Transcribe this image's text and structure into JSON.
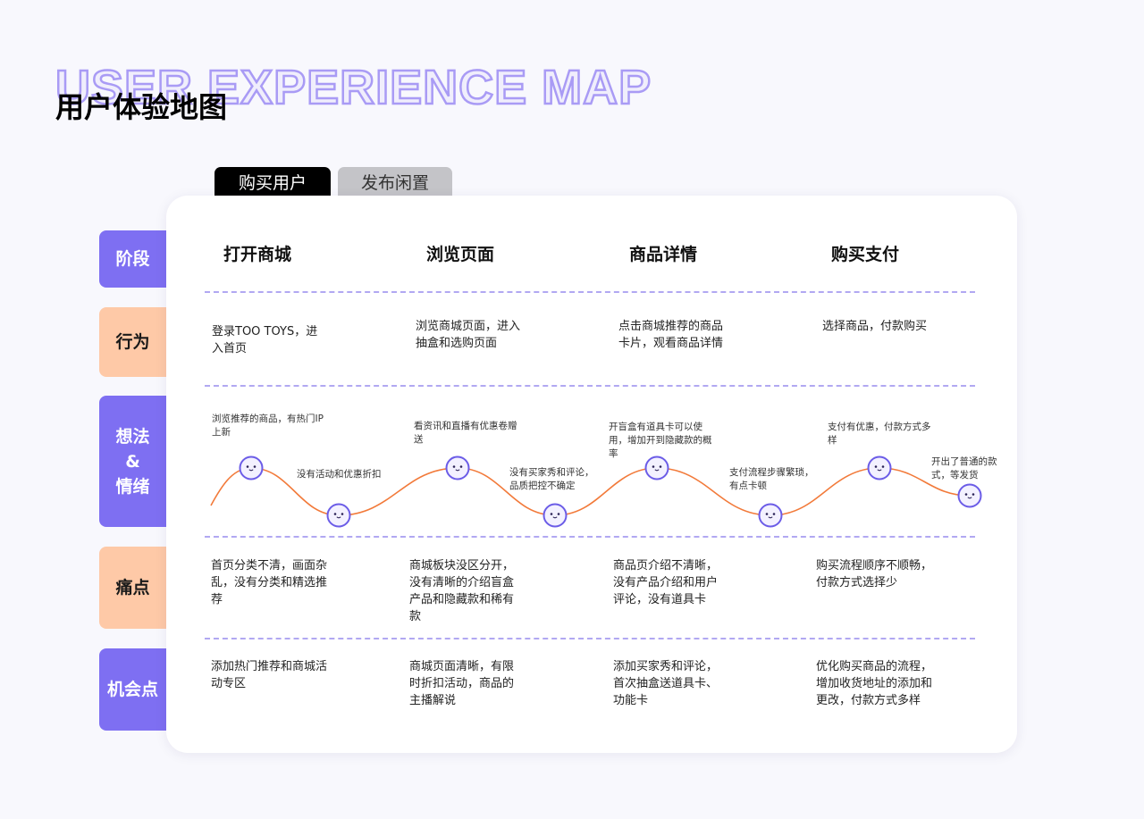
{
  "header": {
    "bg_title": "USER EXPERIENCE MAP",
    "title": "用户体验地图"
  },
  "tabs": [
    {
      "label": "购买用户",
      "active": true
    },
    {
      "label": "发布闲置",
      "active": false
    }
  ],
  "rows": {
    "stage": "阶段",
    "behavior": "行为",
    "thought": "想法\n&\n情绪",
    "pain": "痛点",
    "opportunity": "机会点"
  },
  "stages": [
    "打开商城",
    "浏览页面",
    "商品详情",
    "购买支付"
  ],
  "behaviors": [
    "登录TOO TOYS，进入首页",
    "浏览商城页面，进入抽盒和选购页面",
    "点击商城推荐的商品卡片，观看商品详情",
    "选择商品，付款购买"
  ],
  "thoughts": [
    "浏览推荐的商品，有热门IP上新",
    "没有活动和优惠折扣",
    "看资讯和直播有优惠卷赠送",
    "没有买家秀和评论，品质把控不确定",
    "开盲盒有道具卡可以使用，增加开到隐藏款的概率",
    "支付流程步骤繁琐，有点卡顿",
    "支付有优惠，付款方式多样",
    "开出了普通的款式，等发货"
  ],
  "pain_points": [
    "首页分类不清，画面杂乱，没有分类和精选推荐",
    "商城板块没区分开，没有清晰的介绍盲盒产品和隐藏款和稀有款",
    "商品页介绍不清晰，没有产品介绍和用户评论，没有道具卡",
    "购买流程顺序不顺畅，付款方式选择少"
  ],
  "opportunities": [
    "添加热门推荐和商城活动专区",
    "商城页面清晰，有限时折扣活动，商品的主播解说",
    "添加买家秀和评论，首次抽盒送道具卡、功能卡",
    "优化购买商品的流程，增加收货地址的添加和更改，付款方式多样"
  ],
  "emotion": {
    "levels": [
      "high",
      "low",
      "high",
      "low",
      "high",
      "low",
      "high",
      "low"
    ],
    "icon": "smiley-face-icon",
    "colors": {
      "curve": "#f27a3a",
      "face_border": "#6b5ce7",
      "face_fill": "#f3f1ff"
    }
  }
}
